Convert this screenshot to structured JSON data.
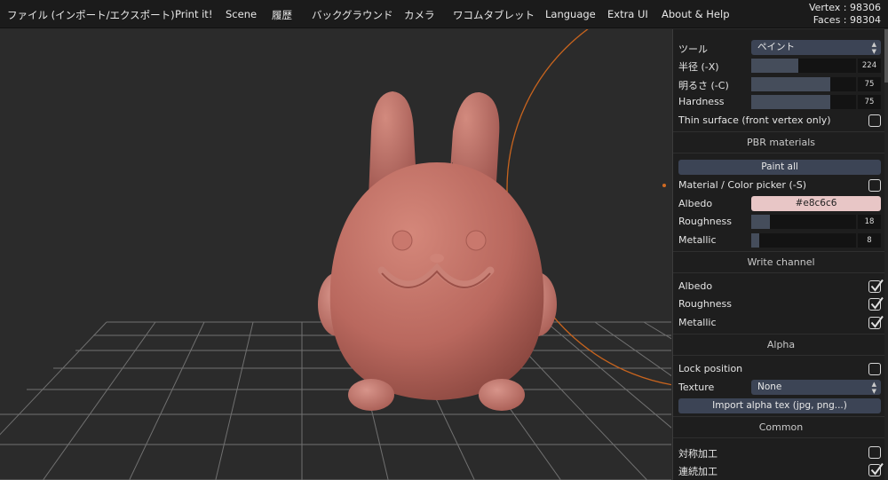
{
  "menu": {
    "items": [
      {
        "label": "ファイル (インポート/エクスポート)"
      },
      {
        "label": "Print it!"
      },
      {
        "label": "Scene"
      },
      {
        "label": "履歴"
      },
      {
        "label": "バックグラウンド"
      },
      {
        "label": "カメラ"
      },
      {
        "label": "ワコムタブレット"
      },
      {
        "label": "Language"
      },
      {
        "label": "Extra UI"
      },
      {
        "label": "About & Help"
      }
    ]
  },
  "stats": {
    "vertex": "Vertex : 98306",
    "faces": "Faces : 98304"
  },
  "panel": {
    "tool": {
      "label": "ツール",
      "value": "ペイント"
    },
    "radius": {
      "label": "半径 (-X)",
      "value": 224,
      "max": 500
    },
    "intensity": {
      "label": "明るさ (-C)",
      "value": 75,
      "max": 100
    },
    "hardness": {
      "label": "Hardness",
      "value": 75,
      "max": 100
    },
    "thin_surface": {
      "label": "Thin surface (front vertex only)",
      "checked": false
    },
    "pbr": {
      "title": "PBR materials",
      "paint_all": "Paint all",
      "picker": {
        "label": "Material / Color picker (-S)",
        "checked": false
      },
      "albedo": {
        "label": "Albedo",
        "value": "#e8c6c6",
        "color": "#e8c6c6"
      },
      "roughness": {
        "label": "Roughness",
        "value": 18,
        "max": 100
      },
      "metallic": {
        "label": "Metallic",
        "value": 8,
        "max": 100
      }
    },
    "write_channel": {
      "title": "Write channel",
      "albedo": {
        "label": "Albedo",
        "checked": true
      },
      "roughness": {
        "label": "Roughness",
        "checked": true
      },
      "metallic": {
        "label": "Metallic",
        "checked": true
      }
    },
    "alpha": {
      "title": "Alpha",
      "lock_position": {
        "label": "Lock position",
        "checked": false
      },
      "texture": {
        "label": "Texture",
        "value": "None"
      },
      "import": "Import alpha tex (jpg, png...)"
    },
    "common": {
      "title": "Common",
      "symmetry": {
        "label": "対称加工",
        "checked": false
      },
      "continuous": {
        "label": "連続加工",
        "checked": true
      }
    }
  },
  "colors": {
    "model": "#b9685e",
    "brush_circle": "#c8641e",
    "background": "#2b2b2b",
    "panel": "#1e1e1e"
  }
}
